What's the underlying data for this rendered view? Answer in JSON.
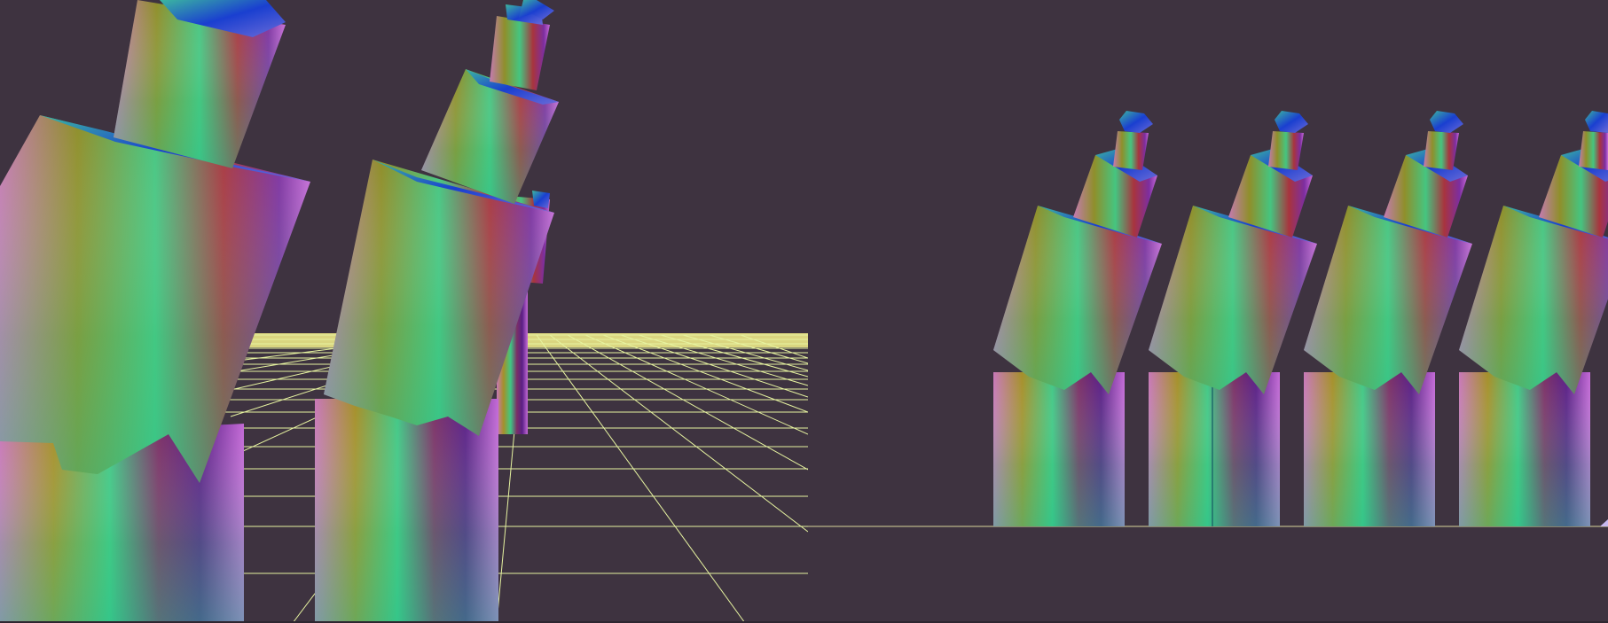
{
  "scene": {
    "background_color": "#3e3340",
    "grid_color": "#eaf79a",
    "grid_far_color": "#f3f08a",
    "floor_line_color": "#d8d49a",
    "material": "normal-shaded"
  },
  "left_viewport": {
    "view": "perspective",
    "objects": [
      {
        "name": "tower-near"
      },
      {
        "name": "tower-mid"
      },
      {
        "name": "tower-far"
      }
    ]
  },
  "right_viewport": {
    "view": "orthographic",
    "objects": [
      {
        "name": "tower-1"
      },
      {
        "name": "tower-2"
      },
      {
        "name": "tower-3"
      },
      {
        "name": "tower-4"
      }
    ]
  }
}
